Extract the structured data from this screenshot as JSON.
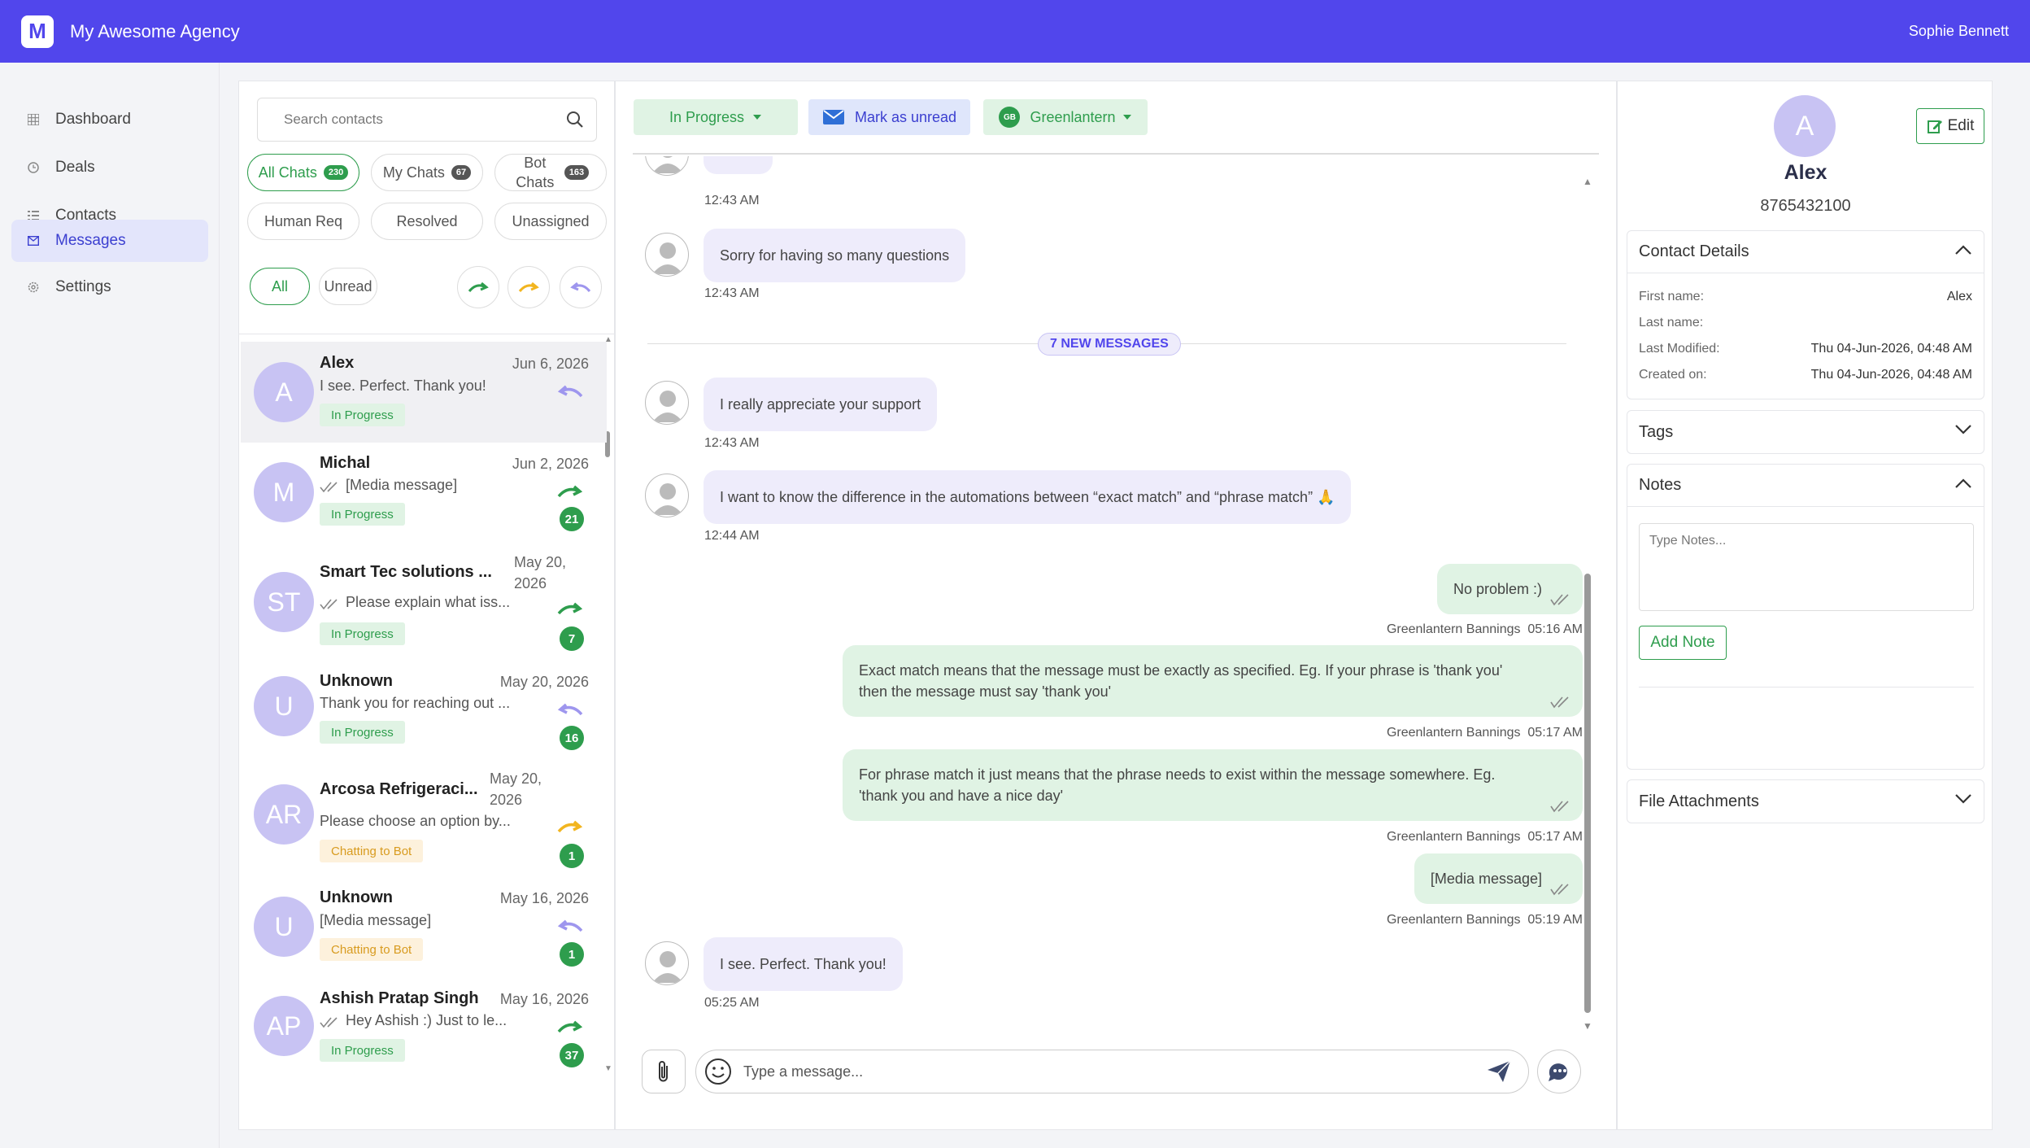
{
  "header": {
    "logo_letter": "M",
    "app_title": "My Awesome Agency",
    "user_name": "Sophie Bennett"
  },
  "sidebar": {
    "items": [
      {
        "label": "Dashboard",
        "icon": "grid-icon"
      },
      {
        "label": "Deals",
        "icon": "clock-icon"
      },
      {
        "label": "Contacts",
        "icon": "list-icon"
      },
      {
        "label": "Messages",
        "icon": "mail-icon",
        "active": true
      },
      {
        "label": "Settings",
        "icon": "gear-icon"
      }
    ]
  },
  "contacts_panel": {
    "search_placeholder": "Search contacts",
    "tabs": [
      {
        "label": "All Chats",
        "count": "230",
        "active": true
      },
      {
        "label": "My Chats",
        "count": "67"
      },
      {
        "label": "Bot Chats",
        "count": "163"
      },
      {
        "label": "Human Req"
      },
      {
        "label": "Resolved"
      },
      {
        "label": "Unassigned"
      }
    ],
    "filters": {
      "all": "All",
      "unread": "Unread"
    },
    "contacts": [
      {
        "initials": "A",
        "name": "Alex",
        "date": "Jun 6, 2026",
        "message": "I see. Perfect. Thank you!",
        "status": "In Progress",
        "direction": "incoming",
        "read": false,
        "count": ""
      },
      {
        "initials": "M",
        "name": "Michal",
        "date": "Jun 2, 2026",
        "message": "[Media message]",
        "status": "In Progress",
        "direction": "outgoing",
        "read": true,
        "count": "21"
      },
      {
        "initials": "ST",
        "name": "Smart Tec solutions ...",
        "date": "May 20, 2026",
        "message": "Please explain what iss...",
        "status": "In Progress",
        "direction": "outgoing",
        "read": true,
        "count": "7"
      },
      {
        "initials": "U",
        "name": "Unknown",
        "date": "May 20, 2026",
        "message": "Thank you for reaching out ...",
        "status": "In Progress",
        "direction": "incoming",
        "read": false,
        "count": "16"
      },
      {
        "initials": "AR",
        "name": "Arcosa Refrigeraci...",
        "date": "May 20, 2026",
        "message": "Please choose an option by...",
        "status": "Chatting to Bot",
        "direction": "bot",
        "read": false,
        "count": "1"
      },
      {
        "initials": "U",
        "name": "Unknown",
        "date": "May 16, 2026",
        "message": "[Media message]",
        "status": "Chatting to Bot",
        "direction": "incoming",
        "read": false,
        "count": "1"
      },
      {
        "initials": "AP",
        "name": "Ashish Pratap Singh",
        "date": "May 16, 2026",
        "message": "Hey Ashish :) Just to le...",
        "status": "In Progress",
        "direction": "outgoing",
        "read": true,
        "count": "37"
      }
    ]
  },
  "chat": {
    "status_button": "In Progress",
    "mark_unread_button": "Mark as unread",
    "assignee_initials": "GB",
    "assignee_button": "Greenlantern",
    "new_messages_divider": "7 NEW MESSAGES",
    "messages": [
      {
        "dir": "in",
        "text": "",
        "time": "12:43 AM"
      },
      {
        "dir": "in",
        "text": "Sorry for having so many questions",
        "time": "12:43 AM"
      },
      {
        "dir": "in",
        "text": "I really appreciate your support",
        "time": "12:43 AM"
      },
      {
        "dir": "in",
        "text": "I want to know the difference in the automations between “exact match” and “phrase match” 🙏",
        "time": "12:44 AM"
      },
      {
        "dir": "out",
        "text": "No problem :)",
        "sender": "Greenlantern Bannings",
        "time": "05:16 AM"
      },
      {
        "dir": "out",
        "text": "Exact match means that the message must be exactly as specified. Eg. If your phrase is 'thank you' then the message must say 'thank you'",
        "sender": "Greenlantern Bannings",
        "time": "05:17 AM"
      },
      {
        "dir": "out",
        "text": "For phrase match it just means that the phrase needs to exist within the message somewhere. Eg. 'thank you and have a nice day'",
        "sender": "Greenlantern Bannings",
        "time": "05:17 AM"
      },
      {
        "dir": "out",
        "text": "[Media message]",
        "sender": "Greenlantern Bannings",
        "time": "05:19 AM"
      },
      {
        "dir": "in",
        "text": "I see. Perfect. Thank you!",
        "time": "05:25 AM"
      }
    ],
    "composer_placeholder": "Type a message..."
  },
  "profile": {
    "initial": "A",
    "name": "Alex",
    "phone": "8765432100",
    "edit_button": "Edit",
    "contact_details": {
      "title": "Contact Details",
      "first_name_label": "First name:",
      "first_name": "Alex",
      "last_name_label": "Last name:",
      "last_name": "",
      "last_modified_label": "Last Modified:",
      "last_modified": "Thu 04-Jun-2026, 04:48 AM",
      "created_on_label": "Created on:",
      "created_on": "Thu 04-Jun-2026, 04:48 AM"
    },
    "tags_title": "Tags",
    "notes_title": "Notes",
    "notes_placeholder": "Type Notes...",
    "add_note_button": "Add Note",
    "files_title": "File Attachments"
  },
  "colors": {
    "brand": "#5146ec",
    "green": "#2e9d4d",
    "amber": "#d89b1f",
    "avatar": "#c8c3f3"
  }
}
